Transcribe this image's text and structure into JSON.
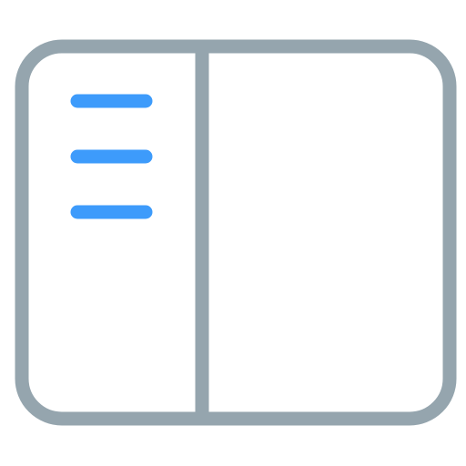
{
  "icon": {
    "name": "sidebar-layout-icon",
    "colors": {
      "frame": "#95A5AE",
      "menu_lines": "#3D9BFB",
      "background": "#FFFFFF"
    },
    "menu_line_count": 3
  }
}
